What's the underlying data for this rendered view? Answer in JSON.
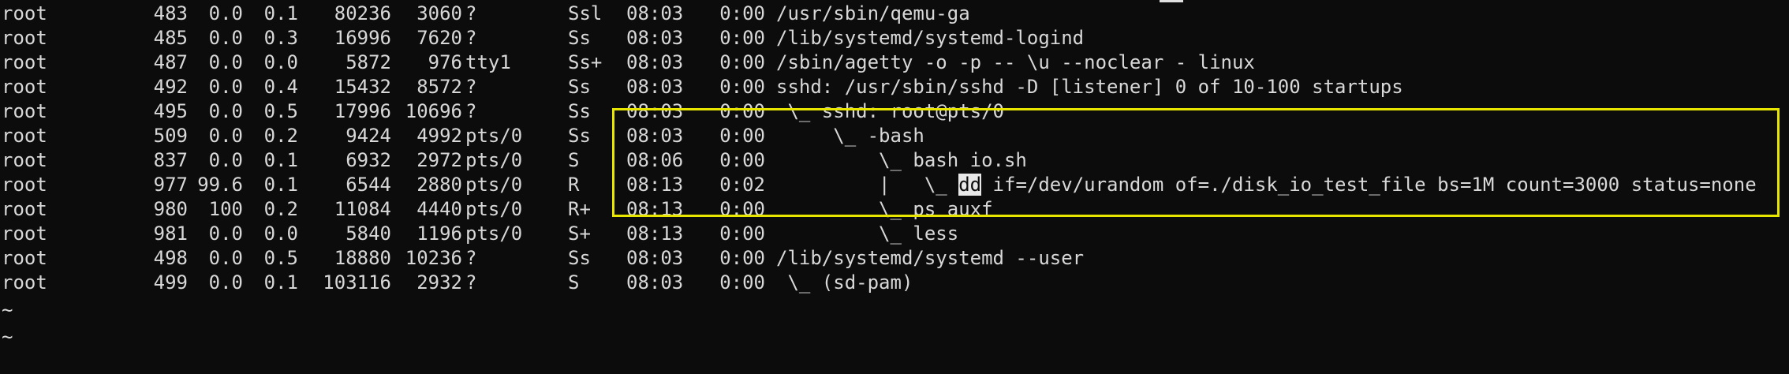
{
  "terminal": {
    "foreground": "#d8d8d8",
    "background": "#0c0c0c",
    "highlight_box_color": "#e6e600"
  },
  "processes": [
    {
      "user": "root",
      "pid": "483",
      "cpu": "0.0",
      "mem": "0.1",
      "vsz": "80236",
      "rss": "3060",
      "tty": "?",
      "stat": "Ssl",
      "start": "08:03",
      "time": "0:00",
      "command": "/usr/sbin/qemu-ga"
    },
    {
      "user": "root",
      "pid": "485",
      "cpu": "0.0",
      "mem": "0.3",
      "vsz": "16996",
      "rss": "7620",
      "tty": "?",
      "stat": "Ss",
      "start": "08:03",
      "time": "0:00",
      "command": "/lib/systemd/systemd-logind"
    },
    {
      "user": "root",
      "pid": "487",
      "cpu": "0.0",
      "mem": "0.0",
      "vsz": "5872",
      "rss": "976",
      "tty": "tty1",
      "stat": "Ss+",
      "start": "08:03",
      "time": "0:00",
      "command": "/sbin/agetty -o -p -- \\u --noclear - linux"
    },
    {
      "user": "root",
      "pid": "492",
      "cpu": "0.0",
      "mem": "0.4",
      "vsz": "15432",
      "rss": "8572",
      "tty": "?",
      "stat": "Ss",
      "start": "08:03",
      "time": "0:00",
      "command": "sshd: /usr/sbin/sshd -D [listener] 0 of 10-100 startups"
    },
    {
      "user": "root",
      "pid": "495",
      "cpu": "0.0",
      "mem": "0.5",
      "vsz": "17996",
      "rss": "10696",
      "tty": "?",
      "stat": "Ss",
      "start": "08:03",
      "time": "0:00",
      "command": " \\_ sshd: root@pts/0"
    },
    {
      "user": "root",
      "pid": "509",
      "cpu": "0.0",
      "mem": "0.2",
      "vsz": "9424",
      "rss": "4992",
      "tty": "pts/0",
      "stat": "Ss",
      "start": "08:03",
      "time": "0:00",
      "command": "     \\_ -bash"
    },
    {
      "user": "root",
      "pid": "837",
      "cpu": "0.0",
      "mem": "0.1",
      "vsz": "6932",
      "rss": "2972",
      "tty": "pts/0",
      "stat": "S",
      "start": "08:06",
      "time": "0:00",
      "command": "         \\_ bash io.sh"
    },
    {
      "user": "root",
      "pid": "977",
      "cpu": "99.6",
      "mem": "0.1",
      "vsz": "6544",
      "rss": "2880",
      "tty": "pts/0",
      "stat": "R",
      "start": "08:13",
      "time": "0:02",
      "command_prefix": "         |   \\_ ",
      "command_highlight": "dd",
      "command_suffix": " if=/dev/urandom of=./disk_io_test_file bs=1M count=3000 status=none"
    },
    {
      "user": "root",
      "pid": "980",
      "cpu": "100",
      "mem": "0.2",
      "vsz": "11084",
      "rss": "4440",
      "tty": "pts/0",
      "stat": "R+",
      "start": "08:13",
      "time": "0:00",
      "command": "         \\_ ps auxf"
    },
    {
      "user": "root",
      "pid": "981",
      "cpu": "0.0",
      "mem": "0.0",
      "vsz": "5840",
      "rss": "1196",
      "tty": "pts/0",
      "stat": "S+",
      "start": "08:13",
      "time": "0:00",
      "command": "         \\_ less"
    },
    {
      "user": "root",
      "pid": "498",
      "cpu": "0.0",
      "mem": "0.5",
      "vsz": "18880",
      "rss": "10236",
      "tty": "?",
      "stat": "Ss",
      "start": "08:03",
      "time": "0:00",
      "command": "/lib/systemd/systemd --user"
    },
    {
      "user": "root",
      "pid": "499",
      "cpu": "0.0",
      "mem": "0.1",
      "vsz": "103116",
      "rss": "2932",
      "tty": "?",
      "stat": "S",
      "start": "08:03",
      "time": "0:00",
      "command": " \\_ (sd-pam)"
    }
  ],
  "tildes": [
    "~",
    "~"
  ]
}
